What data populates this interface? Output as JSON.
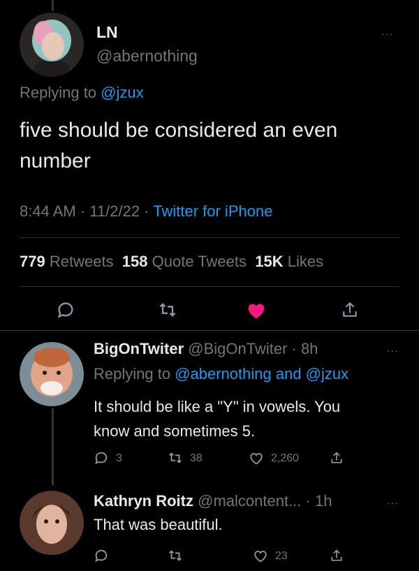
{
  "main_tweet": {
    "name": "LN",
    "handle": "@abernothing",
    "replying_prefix": "Replying to",
    "replying_to": "@jzux",
    "text_line1": "five should be considered an even",
    "text_line2": "number",
    "time": "8:44 AM",
    "date": "11/2/22",
    "source": "Twitter for iPhone",
    "retweets_count": "779",
    "retweets_label": "Retweets",
    "quotes_count": "158",
    "quotes_label": "Quote Tweets",
    "likes_count": "15K",
    "likes_label": "Likes",
    "more": "···"
  },
  "replies": [
    {
      "name": "BigOnTwiter",
      "handle": "@BigOnTwiter",
      "time": "8h",
      "replying_prefix": "Replying to",
      "replying_to": "@abernothing and @jzux",
      "text_line1": "It should be like a \"Y\" in vowels. You",
      "text_line2": "know and sometimes 5.",
      "replies": "3",
      "retweets": "38",
      "likes": "2,260",
      "more": "···"
    },
    {
      "name": "Kathryn Roitz",
      "handle": "@malcontent...",
      "time": "1h",
      "text_line1": "That was beautiful.",
      "likes": "23",
      "more": "···"
    }
  ],
  "colors": {
    "accent": "#1d9bf0",
    "like": "#f91880",
    "muted": "#71767b"
  }
}
